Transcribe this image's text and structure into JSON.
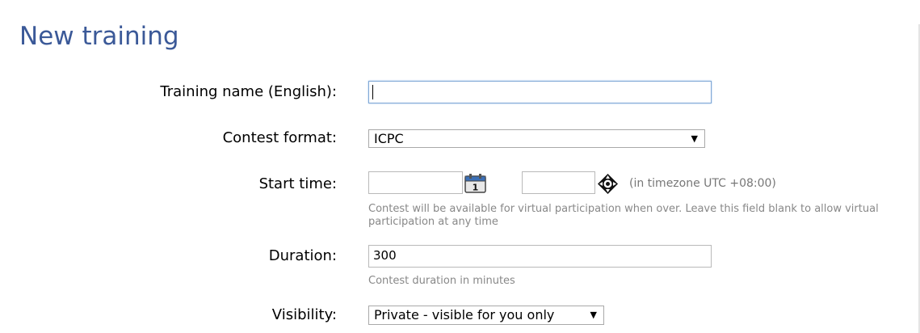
{
  "page": {
    "title": "New training"
  },
  "form": {
    "name": {
      "label": "Training name (English):",
      "value": ""
    },
    "format": {
      "label": "Contest format:",
      "selected": "ICPC",
      "arrow": "▼"
    },
    "start_time": {
      "label": "Start time:",
      "date_value": "",
      "time_value": "",
      "calendar_day": "1",
      "timezone_note": "(in timezone UTC +08:00)",
      "hint": "Contest will be available for virtual participation when over. Leave this field blank to allow virtual participation at any time"
    },
    "duration": {
      "label": "Duration:",
      "value": "300",
      "hint": "Contest duration in minutes"
    },
    "visibility": {
      "label": "Visibility:",
      "selected": "Private - visible for you only",
      "arrow": "▼"
    }
  },
  "colors": {
    "title": "#3b5998",
    "hint": "#888888",
    "focus_border": "#7fa7d6"
  },
  "icons": {
    "calendar": "calendar-icon",
    "time_picker": "time-picker-icon"
  }
}
